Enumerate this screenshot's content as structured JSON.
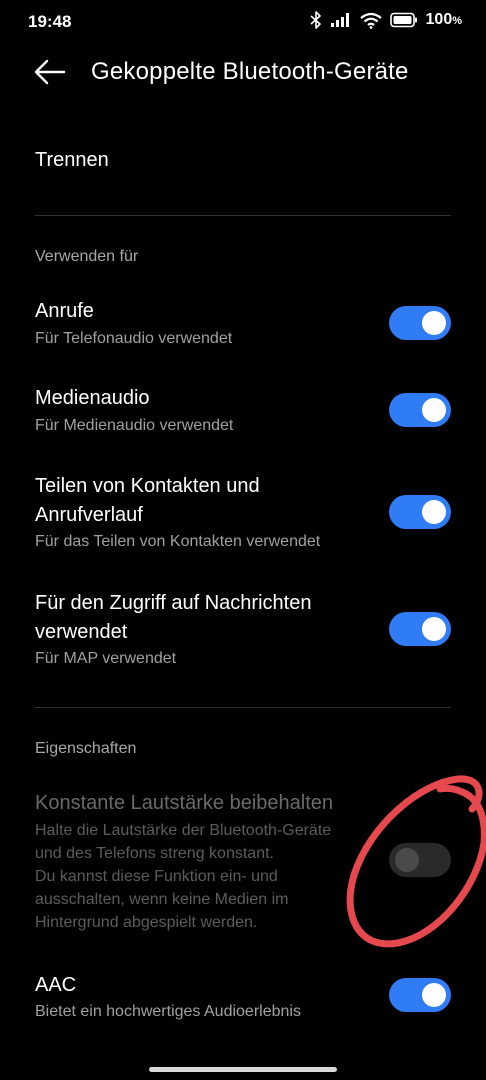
{
  "status_bar": {
    "time": "19:48",
    "battery": "100",
    "icons": [
      "bluetooth-icon",
      "signal-icon",
      "wifi-icon",
      "battery-icon"
    ]
  },
  "header": {
    "back_icon": "arrow-left-icon",
    "title": "Gekoppelte Bluetooth-Geräte"
  },
  "disconnect": {
    "label": "Trennen"
  },
  "section_use": {
    "heading": "Verwenden für"
  },
  "rows_use": [
    {
      "title": "Anrufe",
      "subtitle": "Für Telefonaudio verwendet",
      "enabled": true
    },
    {
      "title": "Medienaudio",
      "subtitle": "Für Medienaudio verwendet",
      "enabled": true
    },
    {
      "title_line1": "Teilen von Kontakten und",
      "title_line2": "Anrufverlauf",
      "subtitle": "Für das Teilen von Kontakten verwendet",
      "enabled": true
    },
    {
      "title_line1": "Für den Zugriff auf Nachrichten",
      "title_line2": "verwendet",
      "subtitle": "Für MAP verwendet",
      "enabled": true
    }
  ],
  "section_props": {
    "heading": "Eigenschaften"
  },
  "constant_volume": {
    "title": "Konstante Lautstärke beibehalten",
    "desc_lines": [
      "Halte die Lautstärke der Bluetooth-Geräte",
      "und des Telefons streng konstant.",
      "Du kannst diese Funktion ein- und",
      "ausschalten, wenn keine Medien im",
      "Hintergrund abgespielt werden."
    ],
    "enabled": false
  },
  "aac": {
    "title": "AAC",
    "subtitle": "Bietet ein hochwertiges Audioerlebnis",
    "enabled": true
  },
  "colors": {
    "background": "#000000",
    "accent": "#2f7cf6",
    "annotation": "#e5484d"
  }
}
